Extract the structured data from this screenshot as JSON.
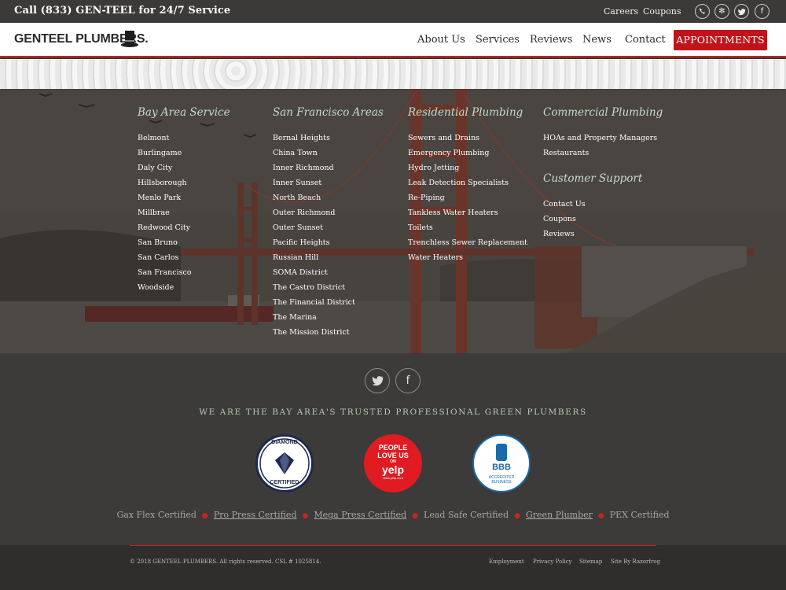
{
  "topbar": {
    "call_text": "Call  (833) GEN-TEEL  for 24/7 Service",
    "careers": "Careers",
    "coupons": "Coupons",
    "social": [
      "phone-icon",
      "yelp-icon",
      "twitter-icon",
      "facebook-icon"
    ]
  },
  "header": {
    "logo_text": "GENTEEL PLUMBERS.",
    "nav": [
      "About Us",
      "Services",
      "Reviews",
      "News",
      "Contact"
    ],
    "cta": "APPOINTMENTS"
  },
  "footer_cols": {
    "bay_area": {
      "title": "Bay Area Service",
      "items": [
        "Belmont",
        "Burlingame",
        "Daly City",
        "Hillsborough",
        "Menlo Park",
        "Millbrae",
        "Redwood City",
        "San Bruno",
        "San Carlos",
        "San Francisco",
        "Woodside"
      ]
    },
    "sf_areas": {
      "title": "San Francisco Areas",
      "items": [
        "Bernal Heights",
        "China Town",
        "Inner Richmond",
        "Inner Sunset",
        "North Beach",
        "Outer Richmond",
        "Outer Sunset",
        "Pacific Heights",
        "Russian Hill",
        "SOMA District",
        "The Castro District",
        "The Financial District",
        "The Marina",
        "The Mission District"
      ]
    },
    "residential": {
      "title": "Residential Plumbing",
      "items": [
        "Sewers and Drains",
        "Emergency Plumbing",
        "Hydro Jetting",
        "Leak Detection Specialists",
        "Re-Piping",
        "Tankless Water Heaters",
        "Toilets",
        "Trenchless Sewer Replacement",
        "Water Heaters"
      ]
    },
    "commercial": {
      "title": "Commercial Plumbing",
      "items": [
        "HOAs and Property Managers",
        "Restaurants"
      ]
    },
    "support": {
      "title": "Customer Support",
      "items": [
        "Contact Us",
        "Coupons",
        "Reviews"
      ]
    }
  },
  "lower": {
    "social": [
      "twitter-icon",
      "facebook-icon"
    ],
    "tagline": "WE ARE THE BAY AREA'S TRUSTED PROFESSIONAL GREEN PLUMBERS",
    "badges": {
      "diamond": {
        "top": "DIAMOND",
        "bottom": "CERTIFIED"
      },
      "yelp": {
        "line1": "PEOPLE",
        "line2": "LOVE US",
        "line3": "ON",
        "brand": "yelp",
        "url": "www.yelp.com"
      },
      "bbb": {
        "mark": "BBB",
        "line1": "ACCREDITED",
        "line2": "BUSINESS"
      }
    },
    "certs": [
      "Gax Flex Certified",
      "Pro Press Certified",
      "Mega Press Certified",
      "Lead Safe Certified",
      "Green Plumber",
      "PEX Certified"
    ]
  },
  "bottom": {
    "copyright": "© 2018 GENTEEL PLUMBERS. All rights reserved. CSL # 1025814.",
    "links": [
      "Employment",
      "Privacy Policy",
      "Sitemap",
      "Site By Razorfrog"
    ]
  },
  "colors": {
    "accent": "#c9241f",
    "heading_green": "#c7dcc8",
    "cta": "#c0131a"
  }
}
